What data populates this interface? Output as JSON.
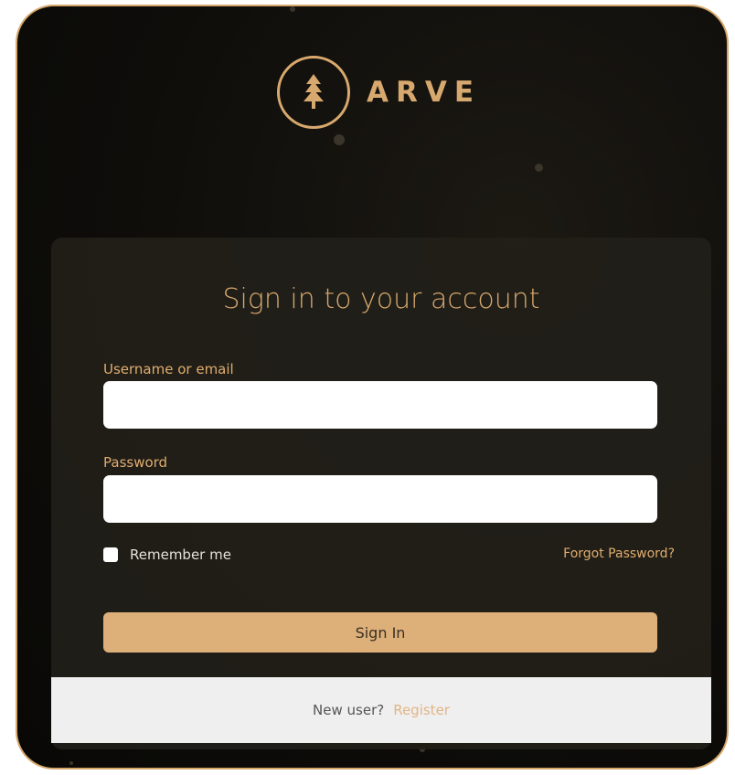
{
  "brand": {
    "name": "ARVE",
    "logo_icon": "tree-icon",
    "accent_color": "#d8a96e"
  },
  "login": {
    "title": "Sign in to your account",
    "username_label": "Username or email",
    "username_value": "",
    "password_label": "Password",
    "password_value": "",
    "remember_label": "Remember me",
    "remember_checked": false,
    "forgot_label": "Forgot Password?",
    "signin_label": "Sign In"
  },
  "footer": {
    "new_user_text": "New user?",
    "register_label": "Register"
  }
}
